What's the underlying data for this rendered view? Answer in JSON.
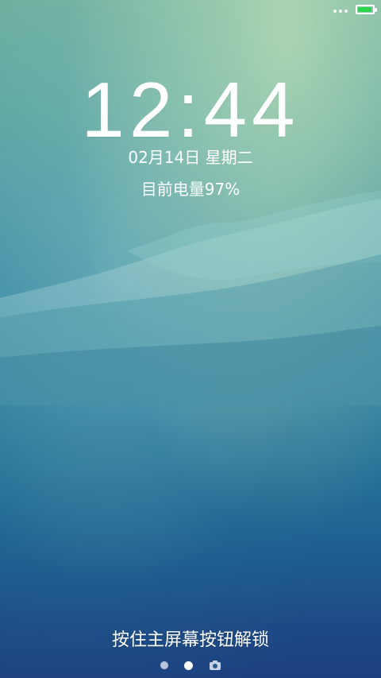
{
  "status_bar": {
    "battery_color": "#27d64a",
    "battery_level_fraction": 0.95
  },
  "lockscreen": {
    "time": "12:44",
    "date": "02月14日 星期二",
    "battery_status": "目前电量97%",
    "unlock_hint": "按住主屏幕按钮解锁"
  },
  "pager": {
    "pages": [
      "dot",
      "dot",
      "camera-icon"
    ],
    "active_index": 1
  },
  "colors": {
    "text": "#ffffff",
    "accent": "#27d64a"
  }
}
